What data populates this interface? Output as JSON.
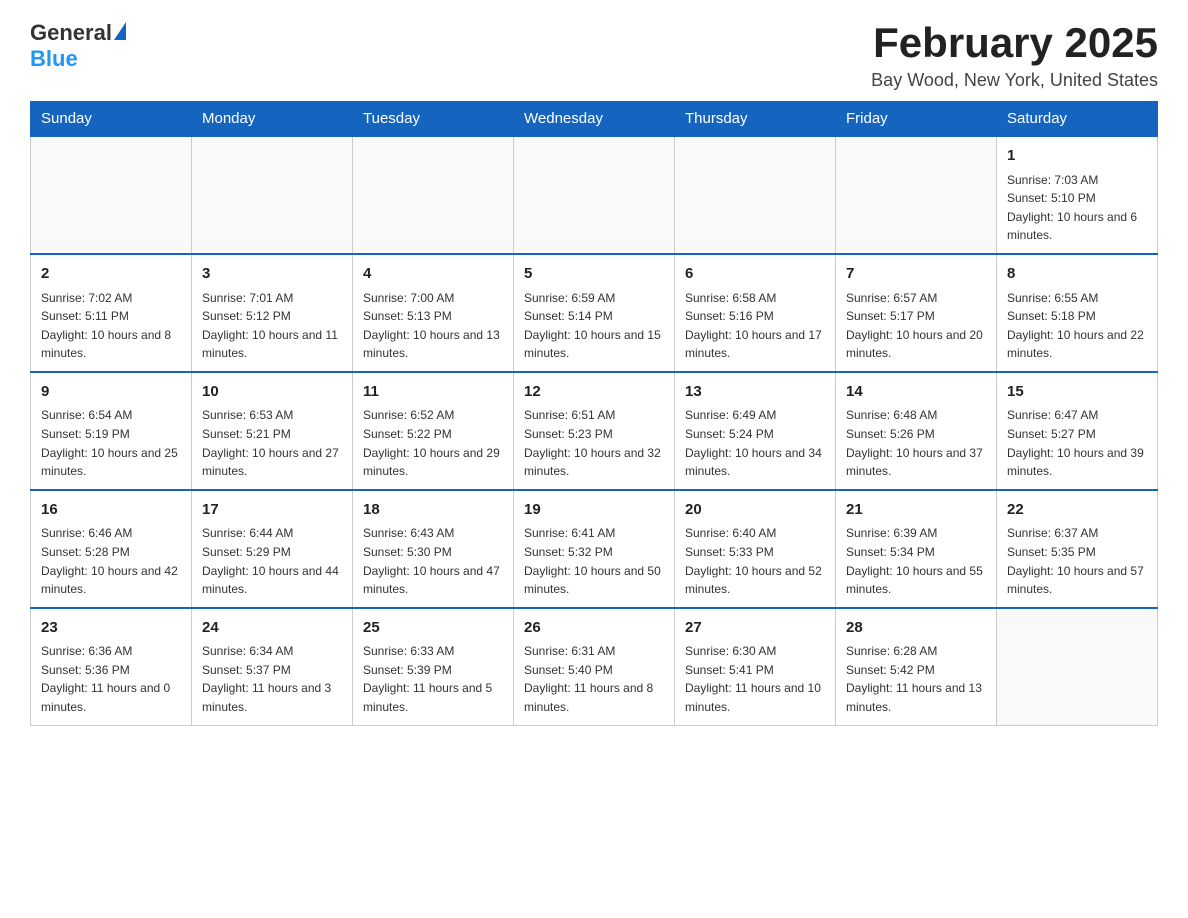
{
  "header": {
    "logo": {
      "general": "General",
      "blue": "Blue"
    },
    "title": "February 2025",
    "location": "Bay Wood, New York, United States"
  },
  "calendar": {
    "days_of_week": [
      "Sunday",
      "Monday",
      "Tuesday",
      "Wednesday",
      "Thursday",
      "Friday",
      "Saturday"
    ],
    "weeks": [
      [
        {
          "day": "",
          "info": ""
        },
        {
          "day": "",
          "info": ""
        },
        {
          "day": "",
          "info": ""
        },
        {
          "day": "",
          "info": ""
        },
        {
          "day": "",
          "info": ""
        },
        {
          "day": "",
          "info": ""
        },
        {
          "day": "1",
          "info": "Sunrise: 7:03 AM\nSunset: 5:10 PM\nDaylight: 10 hours and 6 minutes."
        }
      ],
      [
        {
          "day": "2",
          "info": "Sunrise: 7:02 AM\nSunset: 5:11 PM\nDaylight: 10 hours and 8 minutes."
        },
        {
          "day": "3",
          "info": "Sunrise: 7:01 AM\nSunset: 5:12 PM\nDaylight: 10 hours and 11 minutes."
        },
        {
          "day": "4",
          "info": "Sunrise: 7:00 AM\nSunset: 5:13 PM\nDaylight: 10 hours and 13 minutes."
        },
        {
          "day": "5",
          "info": "Sunrise: 6:59 AM\nSunset: 5:14 PM\nDaylight: 10 hours and 15 minutes."
        },
        {
          "day": "6",
          "info": "Sunrise: 6:58 AM\nSunset: 5:16 PM\nDaylight: 10 hours and 17 minutes."
        },
        {
          "day": "7",
          "info": "Sunrise: 6:57 AM\nSunset: 5:17 PM\nDaylight: 10 hours and 20 minutes."
        },
        {
          "day": "8",
          "info": "Sunrise: 6:55 AM\nSunset: 5:18 PM\nDaylight: 10 hours and 22 minutes."
        }
      ],
      [
        {
          "day": "9",
          "info": "Sunrise: 6:54 AM\nSunset: 5:19 PM\nDaylight: 10 hours and 25 minutes."
        },
        {
          "day": "10",
          "info": "Sunrise: 6:53 AM\nSunset: 5:21 PM\nDaylight: 10 hours and 27 minutes."
        },
        {
          "day": "11",
          "info": "Sunrise: 6:52 AM\nSunset: 5:22 PM\nDaylight: 10 hours and 29 minutes."
        },
        {
          "day": "12",
          "info": "Sunrise: 6:51 AM\nSunset: 5:23 PM\nDaylight: 10 hours and 32 minutes."
        },
        {
          "day": "13",
          "info": "Sunrise: 6:49 AM\nSunset: 5:24 PM\nDaylight: 10 hours and 34 minutes."
        },
        {
          "day": "14",
          "info": "Sunrise: 6:48 AM\nSunset: 5:26 PM\nDaylight: 10 hours and 37 minutes."
        },
        {
          "day": "15",
          "info": "Sunrise: 6:47 AM\nSunset: 5:27 PM\nDaylight: 10 hours and 39 minutes."
        }
      ],
      [
        {
          "day": "16",
          "info": "Sunrise: 6:46 AM\nSunset: 5:28 PM\nDaylight: 10 hours and 42 minutes."
        },
        {
          "day": "17",
          "info": "Sunrise: 6:44 AM\nSunset: 5:29 PM\nDaylight: 10 hours and 44 minutes."
        },
        {
          "day": "18",
          "info": "Sunrise: 6:43 AM\nSunset: 5:30 PM\nDaylight: 10 hours and 47 minutes."
        },
        {
          "day": "19",
          "info": "Sunrise: 6:41 AM\nSunset: 5:32 PM\nDaylight: 10 hours and 50 minutes."
        },
        {
          "day": "20",
          "info": "Sunrise: 6:40 AM\nSunset: 5:33 PM\nDaylight: 10 hours and 52 minutes."
        },
        {
          "day": "21",
          "info": "Sunrise: 6:39 AM\nSunset: 5:34 PM\nDaylight: 10 hours and 55 minutes."
        },
        {
          "day": "22",
          "info": "Sunrise: 6:37 AM\nSunset: 5:35 PM\nDaylight: 10 hours and 57 minutes."
        }
      ],
      [
        {
          "day": "23",
          "info": "Sunrise: 6:36 AM\nSunset: 5:36 PM\nDaylight: 11 hours and 0 minutes."
        },
        {
          "day": "24",
          "info": "Sunrise: 6:34 AM\nSunset: 5:37 PM\nDaylight: 11 hours and 3 minutes."
        },
        {
          "day": "25",
          "info": "Sunrise: 6:33 AM\nSunset: 5:39 PM\nDaylight: 11 hours and 5 minutes."
        },
        {
          "day": "26",
          "info": "Sunrise: 6:31 AM\nSunset: 5:40 PM\nDaylight: 11 hours and 8 minutes."
        },
        {
          "day": "27",
          "info": "Sunrise: 6:30 AM\nSunset: 5:41 PM\nDaylight: 11 hours and 10 minutes."
        },
        {
          "day": "28",
          "info": "Sunrise: 6:28 AM\nSunset: 5:42 PM\nDaylight: 11 hours and 13 minutes."
        },
        {
          "day": "",
          "info": ""
        }
      ]
    ]
  }
}
